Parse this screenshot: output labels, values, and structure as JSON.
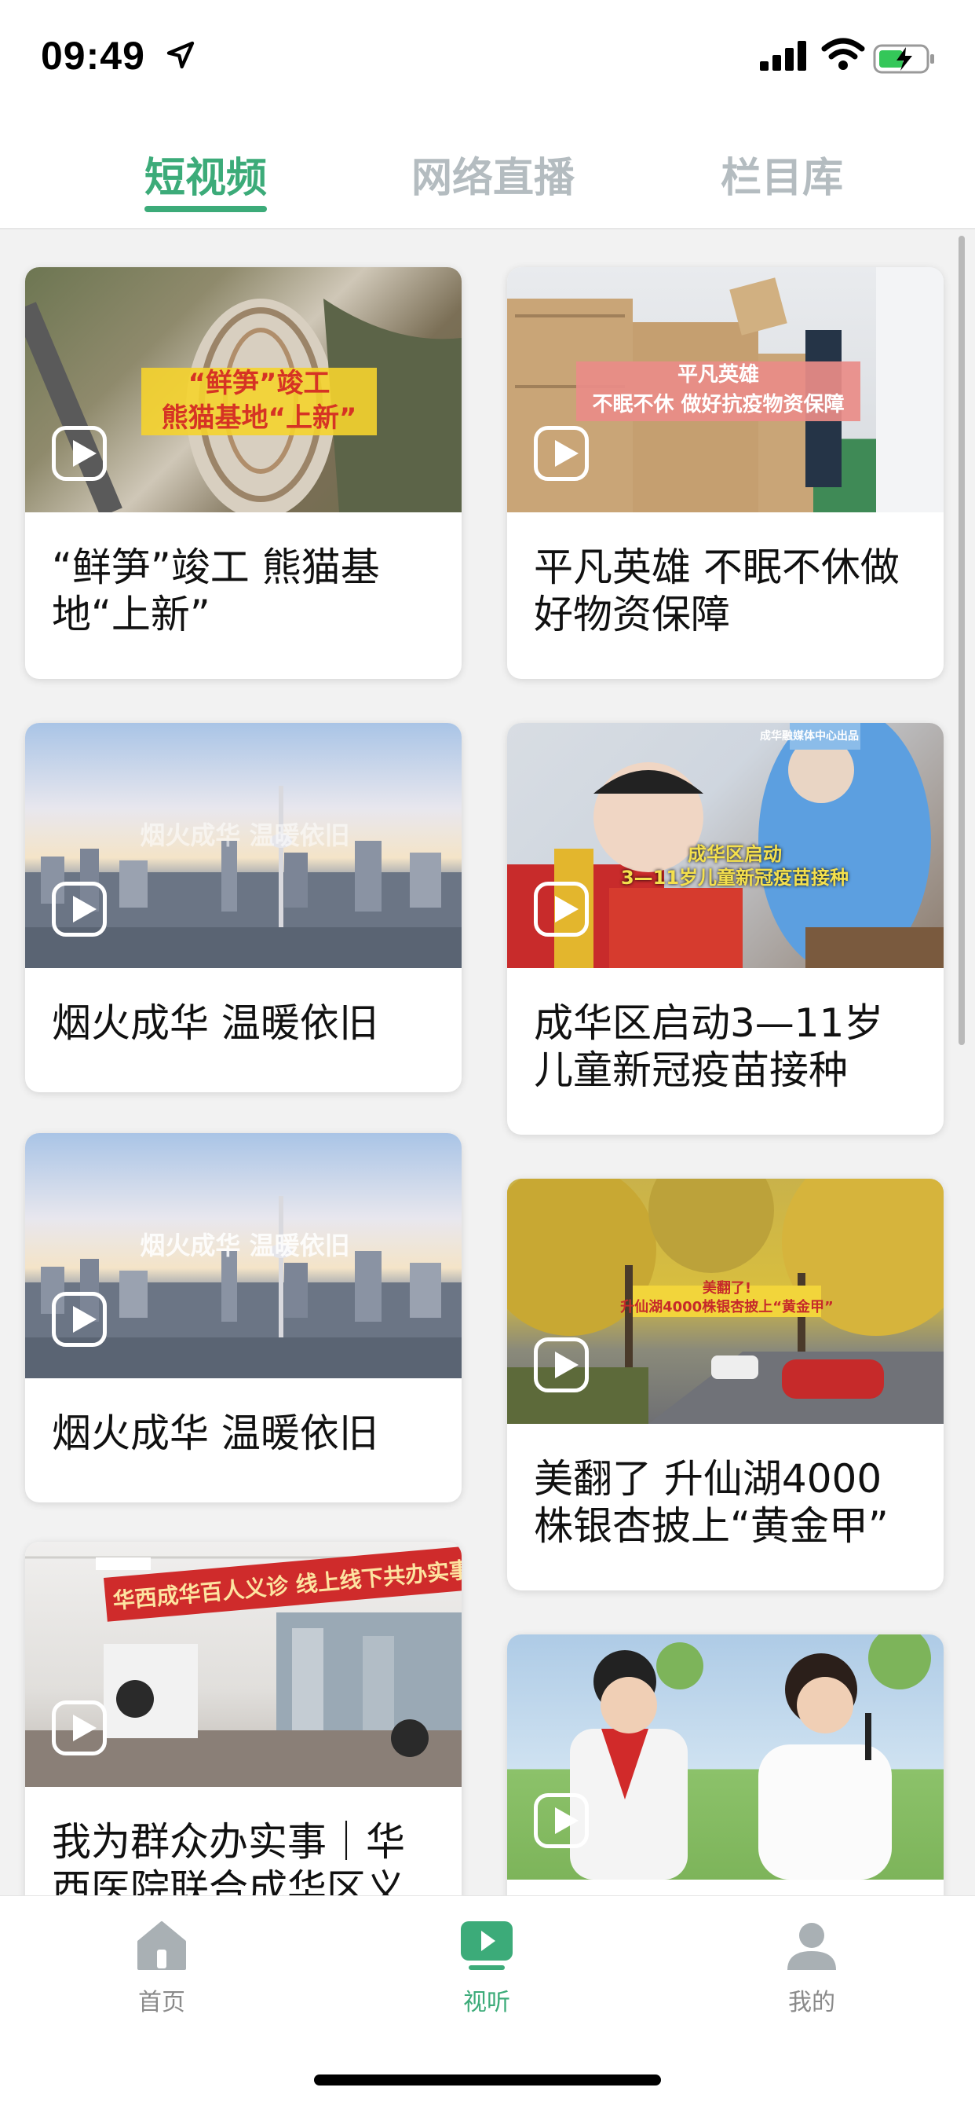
{
  "status": {
    "time": "09:49"
  },
  "tabs": [
    {
      "label": "短视频",
      "active": true
    },
    {
      "label": "网络直播",
      "active": false
    },
    {
      "label": "栏目库",
      "active": false
    }
  ],
  "cards": [
    {
      "caption": "“鲜笋”竣工 熊猫基地“上新”",
      "overlay": [
        "“鲜笋”竣工",
        "熊猫基地“上新”"
      ]
    },
    {
      "caption": "平凡英雄 不眠不休做好物资保障",
      "overlay": [
        "平凡英雄",
        "不眠不休 做好抗疫物资保障"
      ]
    },
    {
      "caption": "烟火成华 温暖依旧",
      "overlay": [
        "烟火成华 温暖依旧"
      ]
    },
    {
      "caption": "成华区启动3—11岁儿童新冠疫苗接种",
      "overlay": [
        "成华区启动",
        "3—11岁儿童新冠疫苗接种"
      ],
      "watermark": "成华融媒体中心出品"
    },
    {
      "caption": "烟火成华 温暖依旧",
      "overlay": [
        "烟火成华 温暖依旧"
      ]
    },
    {
      "caption": "美翻了 升仙湖4000株银杏披上“黄金甲”",
      "overlay": [
        "美翻了!",
        "升仙湖4000株银杏披上“黄金甲”"
      ]
    },
    {
      "caption": "我为群众办实事｜华西医院联合成华区义",
      "overlay": [
        "华西成华百人义诊 线上线下共办实事"
      ]
    },
    {
      "caption": "",
      "overlay": []
    }
  ],
  "bottom_nav": [
    {
      "label": "首页",
      "icon": "home-icon",
      "active": false
    },
    {
      "label": "视听",
      "icon": "video-play-icon",
      "active": true
    },
    {
      "label": "我的",
      "icon": "profile-icon",
      "active": false
    }
  ],
  "colors": {
    "accent": "#3cab79",
    "inactive_tab": "#b4bcc0"
  }
}
